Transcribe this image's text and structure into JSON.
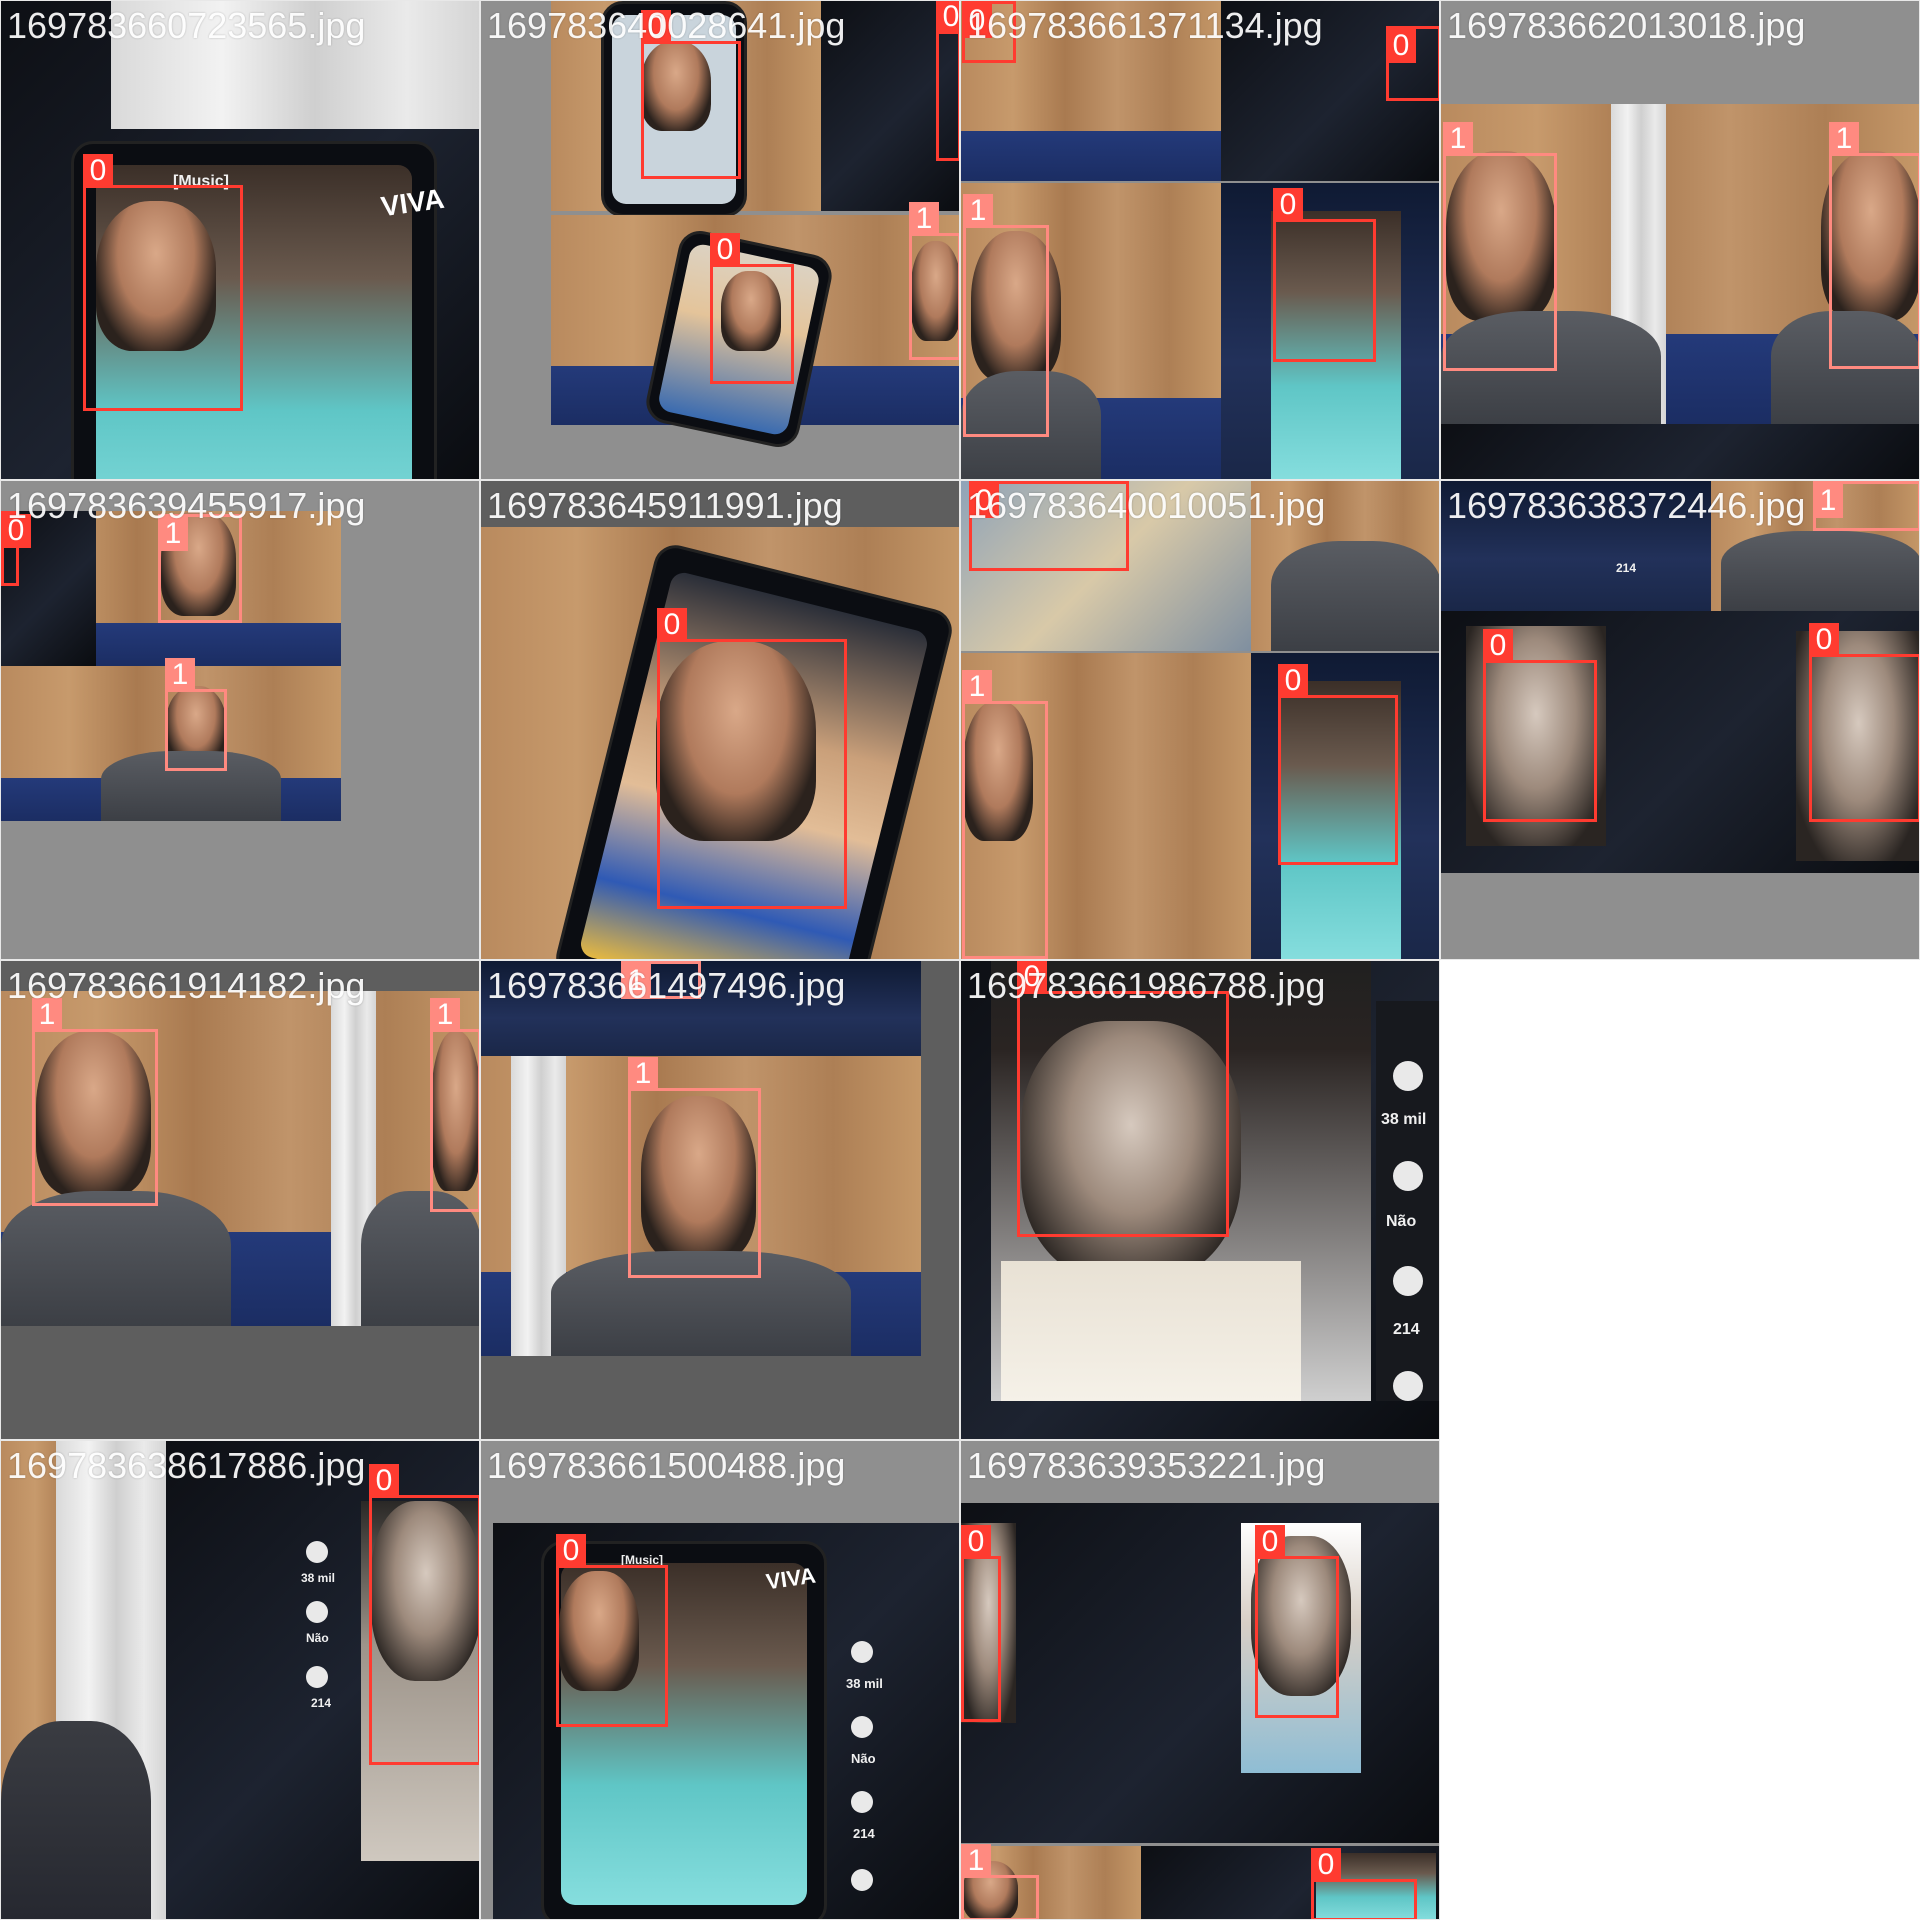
{
  "mosaic": {
    "tiles": [
      {
        "file": "169783660723565.jpg"
      },
      {
        "file": "169783640028641.jpg"
      },
      {
        "file": "169783661371134.jpg"
      },
      {
        "file": "169783662013018.jpg"
      },
      {
        "file": "169783639455917.jpg"
      },
      {
        "file": "169783645911991.jpg"
      },
      {
        "file": "169783640010051.jpg"
      },
      {
        "file": "169783638372446.jpg"
      },
      {
        "file": "169783661914182.jpg"
      },
      {
        "file": "169783661497496.jpg"
      },
      {
        "file": "169783661986788.jpg"
      },
      {
        "file": "169783638617886.jpg"
      },
      {
        "file": "169783661500488.jpg"
      },
      {
        "file": "169783639353221.jpg"
      }
    ],
    "class_labels": {
      "zero": "0",
      "one": "1"
    },
    "class_colors": {
      "zero": "#ff3b30",
      "one": "#ff8a80"
    },
    "overlay_text": {
      "music": "[Music]",
      "viva": "VIVA",
      "likes": "38 mil",
      "nao": "Não",
      "comments": "214"
    }
  }
}
